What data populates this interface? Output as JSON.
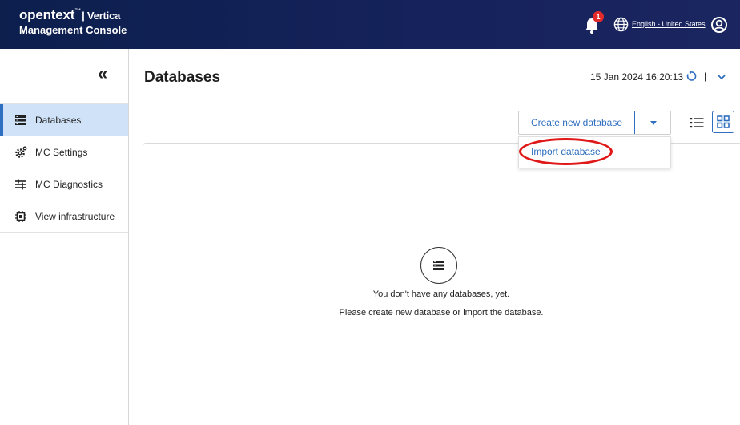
{
  "header": {
    "brand": "opentext",
    "brand_tm": "™",
    "brand_product": "| Vertica",
    "subtitle": "Management Console",
    "notifications_count": "1",
    "language": "English - United States"
  },
  "sidebar": {
    "items": [
      {
        "label": "Databases",
        "icon": "database-list-icon",
        "active": true
      },
      {
        "label": "MC Settings",
        "icon": "settings-gear-icon",
        "active": false
      },
      {
        "label": "MC Diagnostics",
        "icon": "diagnostics-sliders-icon",
        "active": false
      },
      {
        "label": "View infrastructure",
        "icon": "chip-infrastructure-icon",
        "active": false
      }
    ]
  },
  "main": {
    "title": "Databases",
    "datetime": "15 Jan 2024 16:20:13",
    "separator": "|",
    "create_button": "Create new database",
    "menu_item": "Import database",
    "empty_line1": "You don't have any databases, yet.",
    "empty_line2": "Please create new database or import the database."
  },
  "colors": {
    "header_bg": "#16225c",
    "accent": "#2f6fbf",
    "active_nav_bg": "#cfe2f7",
    "highlight_oval": "#e01818",
    "badge": "#e22a2a"
  }
}
